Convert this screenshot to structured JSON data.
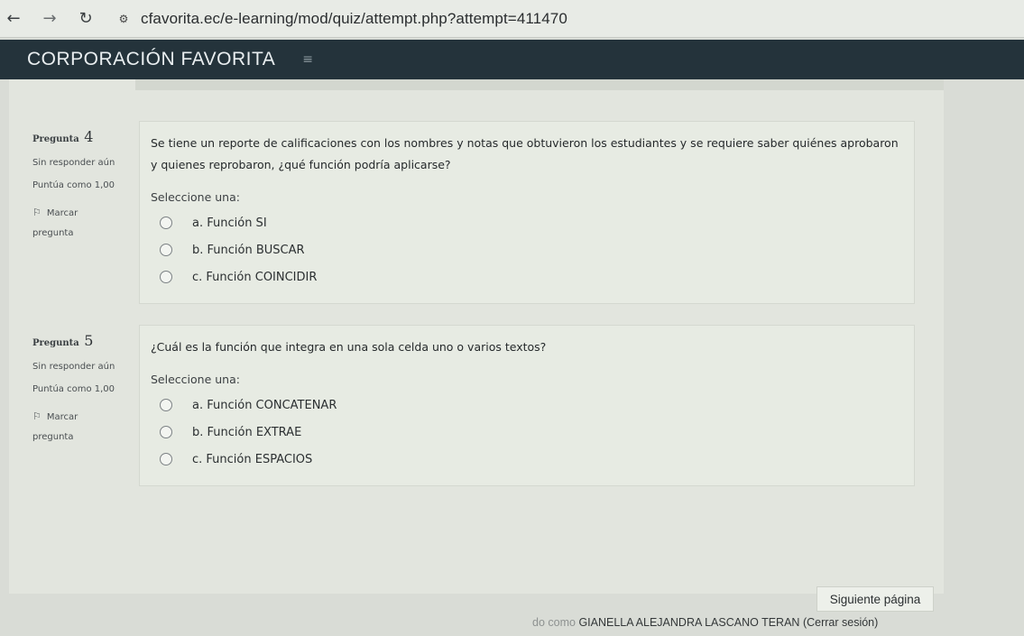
{
  "browser": {
    "back_icon": "back-arrow-icon",
    "forward_icon": "forward-arrow-icon",
    "reload_icon": "reload-icon",
    "site_info_icon": "site-settings-icon",
    "url": "cfavorita.ec/e-learning/mod/quiz/attempt.php?attempt=411470"
  },
  "header": {
    "brand": "CORPORACIÓN FAVORITA",
    "menu_icon": "menu-icon"
  },
  "questions": [
    {
      "title": "Pregunta",
      "number": "4",
      "status": "Sin responder aún",
      "points": "Puntúa como 1,00",
      "flag_label": "Marcar",
      "flag_label2": "pregunta",
      "text": "Se tiene un reporte de calificaciones con los nombres y notas que obtuvieron los estudiantes y se requiere saber quiénes aprobaron y quienes reprobaron, ¿qué función podría aplicarse?",
      "select_label": "Seleccione una:",
      "options": [
        "a. Función SI",
        "b. Función BUSCAR",
        "c. Función COINCIDIR"
      ]
    },
    {
      "title": "Pregunta",
      "number": "5",
      "status": "Sin responder aún",
      "points": "Puntúa como 1,00",
      "flag_label": "Marcar",
      "flag_label2": "pregunta",
      "text": "¿Cuál es la función que integra en una sola celda uno o varios textos?",
      "select_label": "Seleccione una:",
      "options": [
        "a. Función CONCATENAR",
        "b. Función EXTRAE",
        "c. Función ESPACIOS"
      ]
    }
  ],
  "next_button": "Siguiente página",
  "footer": {
    "prefix": "do como",
    "user": "GIANELLA ALEJANDRA LASCANO TERAN",
    "logout": "(Cerrar sesión)"
  },
  "colors": {
    "header_bg": "#24333b",
    "page_bg": "#e2e5de"
  }
}
